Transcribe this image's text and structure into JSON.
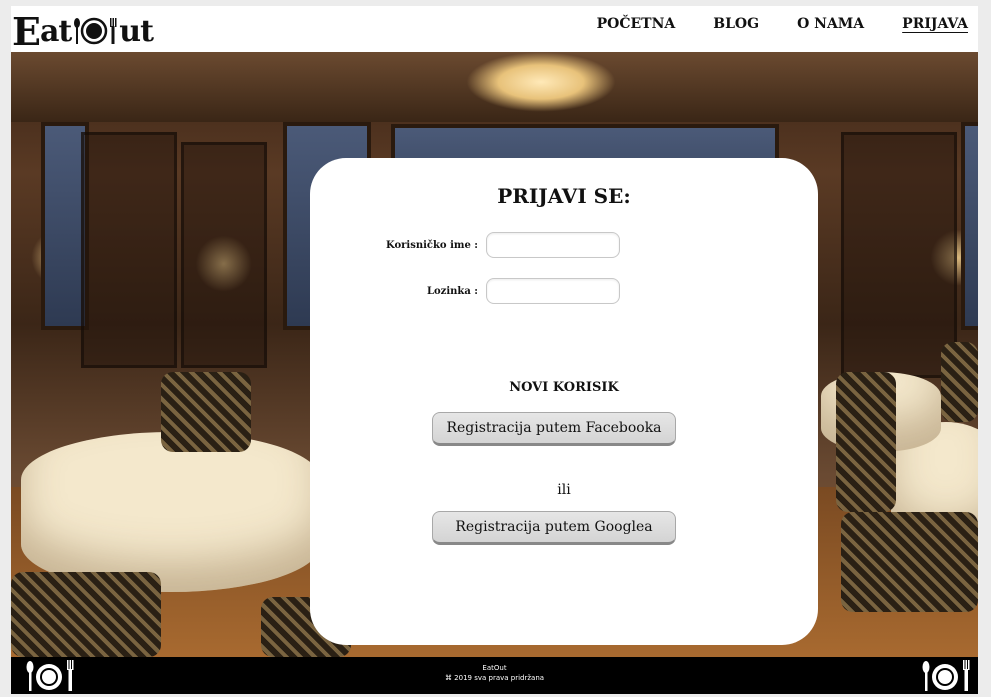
{
  "brand": {
    "logo_text_e": "E",
    "logo_text_at": "at",
    "logo_text_ut": "ut"
  },
  "nav": {
    "items": [
      {
        "label": "POČETNA",
        "active": false
      },
      {
        "label": "BLOG",
        "active": false
      },
      {
        "label": "O NAMA",
        "active": false
      },
      {
        "label": "PRIJAVA",
        "active": true
      }
    ]
  },
  "login": {
    "title": "PRIJAVI SE:",
    "username_label": "Korisničko ime :",
    "username_value": "",
    "password_label": "Lozinka :",
    "password_value": ""
  },
  "register": {
    "title": "NOVI KORISIK",
    "facebook_label": "Registracija putem Facebooka",
    "or_text": "ili",
    "google_label": "Registracija putem Googlea"
  },
  "footer": {
    "brand": "EatOut",
    "copyright": "⌘ 2019 sva prava pridržana"
  },
  "colors": {
    "header_bg": "#ffffff",
    "footer_bg": "#000000",
    "card_bg": "#ffffff",
    "button_bg": "#dcdcdc"
  },
  "icons": [
    "plate-cutlery-icon"
  ]
}
